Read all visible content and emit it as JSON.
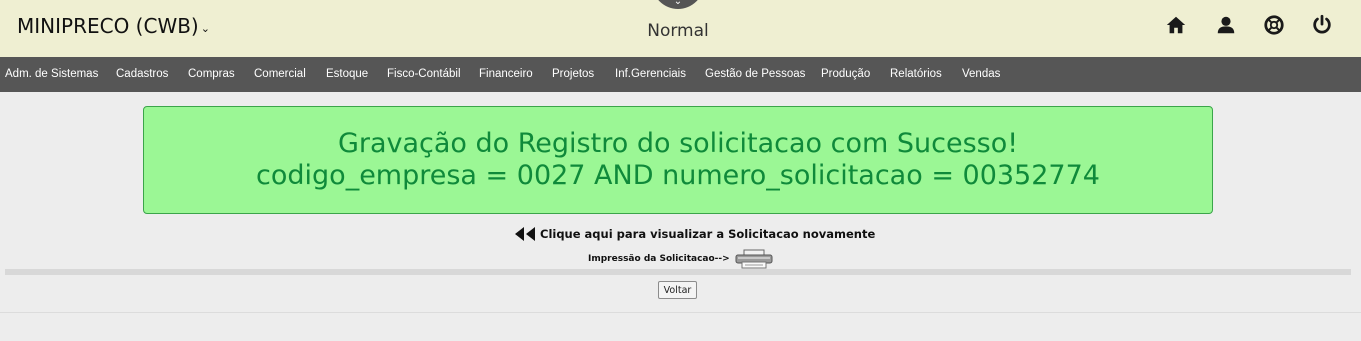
{
  "header": {
    "company": "MINIPRECO (CWB)",
    "mode": "Normal",
    "background_color": "#efefd2"
  },
  "top_icons": [
    "home-icon",
    "user-icon",
    "help-lifebuoy-icon",
    "power-icon"
  ],
  "nav": {
    "background_color": "#565656",
    "items": [
      "Adm. de Sistemas",
      "Cadastros",
      "Compras",
      "Comercial",
      "Estoque",
      "Fisco-Contábil",
      "Financeiro",
      "Projetos",
      "Inf.Gerenciais",
      "Gestão de Pessoas",
      "Produção",
      "Relatórios",
      "Vendas"
    ]
  },
  "message": {
    "line1": "Gravação do Registro do solicitacao com Sucesso!",
    "line2": "codigo_empresa = 0027 AND numero_solicitacao = 00352774",
    "background_color": "#9bf795",
    "text_color": "#0f8a3a"
  },
  "actions": {
    "view_again": "Clique aqui para visualizar a Solicitacao novamente",
    "print_label": "Impressão da Solicitacao-->",
    "back_button": "Voltar"
  }
}
